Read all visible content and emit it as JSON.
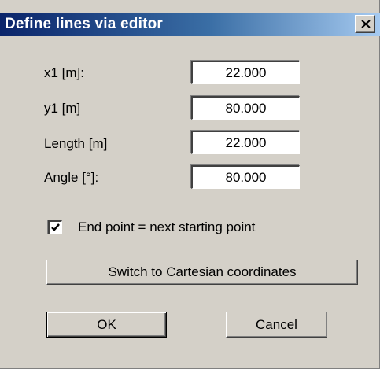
{
  "window": {
    "title": "Define lines via editor",
    "close_glyph": "close-icon"
  },
  "fields": [
    {
      "label": "x1 [m]:",
      "value": "22.000"
    },
    {
      "label": "y1 [m]",
      "value": "80.000"
    },
    {
      "label": "Length [m]",
      "value": "22.000"
    },
    {
      "label": "Angle [°]:",
      "value": "80.000"
    }
  ],
  "checkbox": {
    "label": "End point = next starting point",
    "checked": true
  },
  "buttons": {
    "switch_label": "Switch to Cartesian coordinates",
    "ok_label": "OK",
    "cancel_label": "Cancel"
  },
  "colors": {
    "title_start": "#0a246a",
    "title_end": "#a6caf0",
    "face": "#d4d0c8"
  }
}
